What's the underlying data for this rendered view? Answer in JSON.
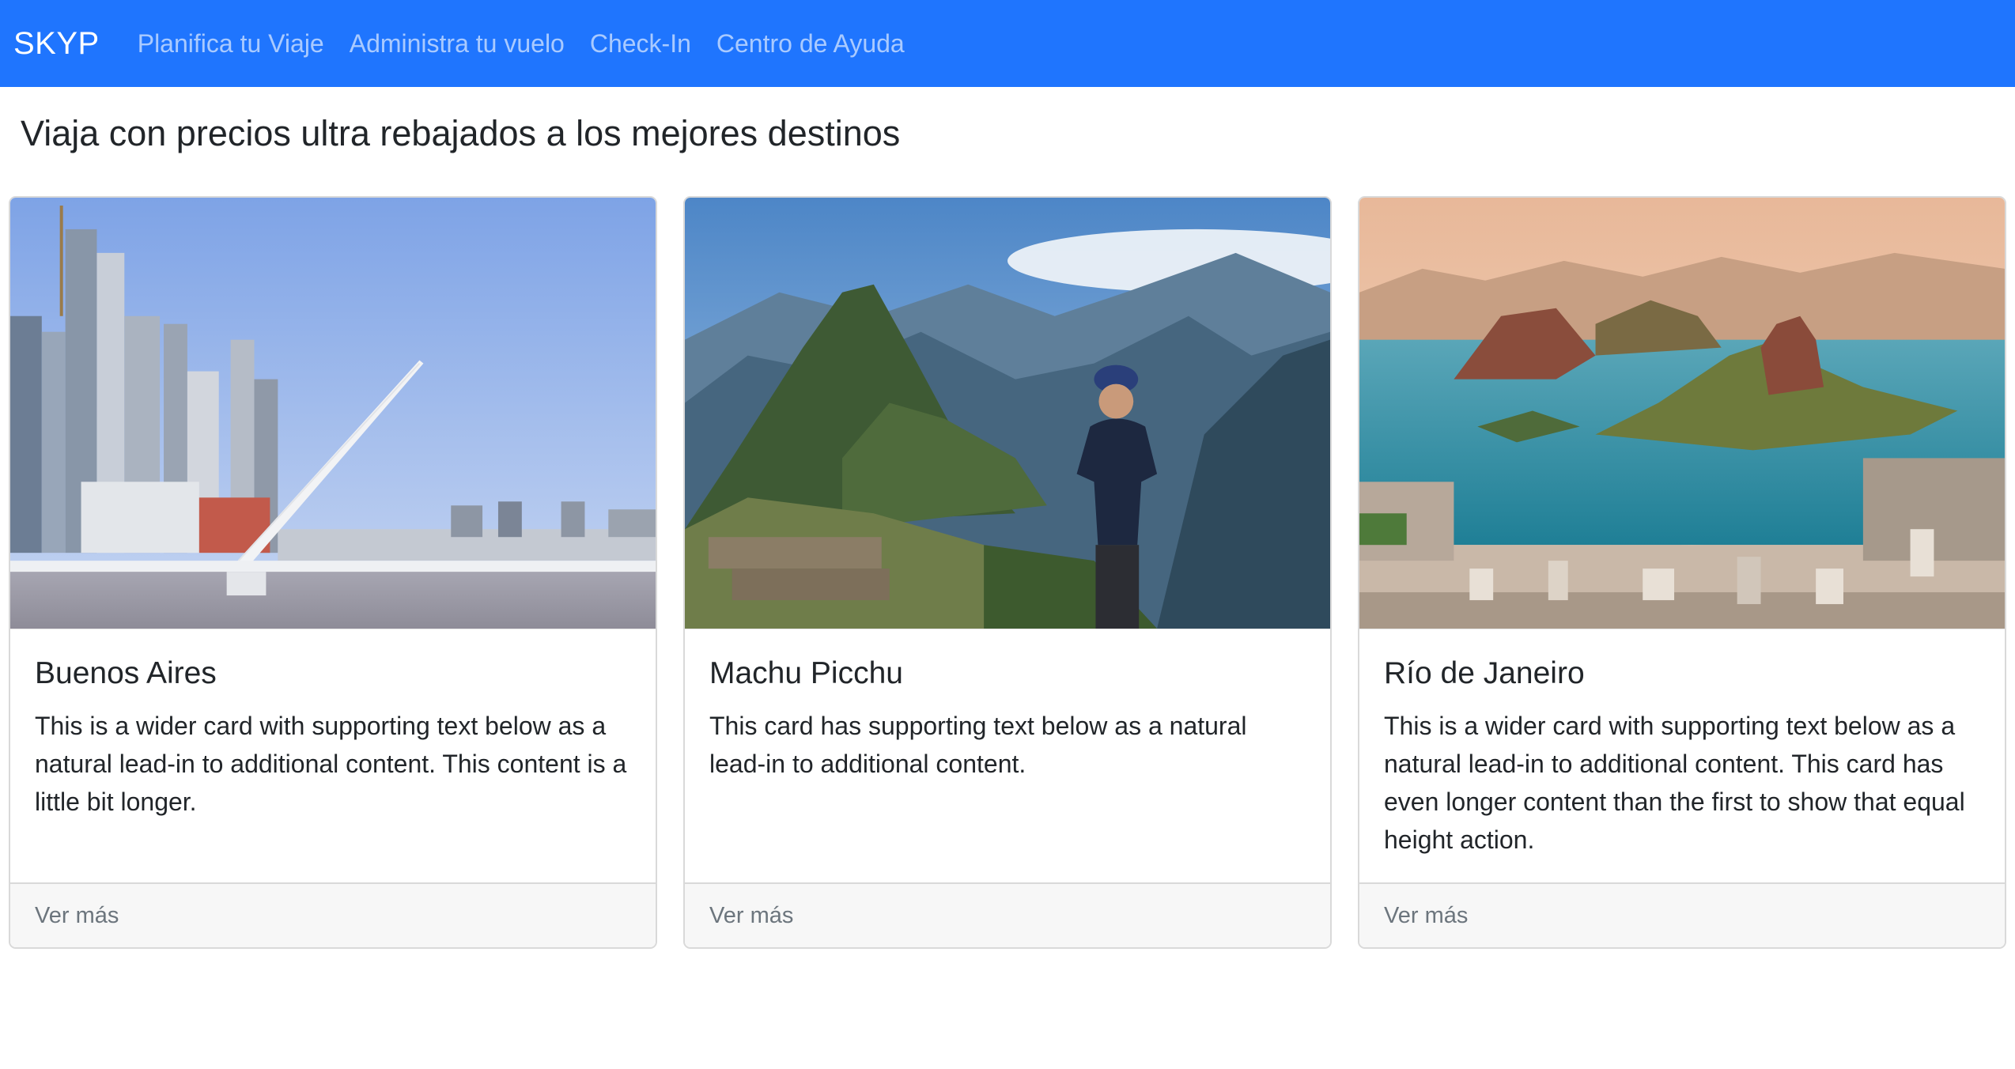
{
  "navbar": {
    "brand": "SKYP",
    "links": [
      {
        "label": "Planifica tu Viaje"
      },
      {
        "label": "Administra tu vuelo"
      },
      {
        "label": "Check-In"
      },
      {
        "label": "Centro de Ayuda"
      }
    ],
    "background": "#1f75fe"
  },
  "main": {
    "title": "Viaja con precios ultra rebajados a los mejores destinos",
    "cards": [
      {
        "title": "Buenos Aires",
        "text": "This is a wider card with supporting text below as a natural lead-in to additional content. This content is a little bit longer.",
        "footer": "Ver más",
        "image": "buenos-aires-photo"
      },
      {
        "title": "Machu Picchu",
        "text": "This card has supporting text below as a natural lead-in to additional content.",
        "footer": "Ver más",
        "image": "machu-picchu-photo"
      },
      {
        "title": "Río de Janeiro",
        "text": "This is a wider card with supporting text below as a natural lead-in to additional content. This card has even longer content than the first to show that equal height action.",
        "footer": "Ver más",
        "image": "rio-de-janeiro-photo"
      }
    ]
  }
}
